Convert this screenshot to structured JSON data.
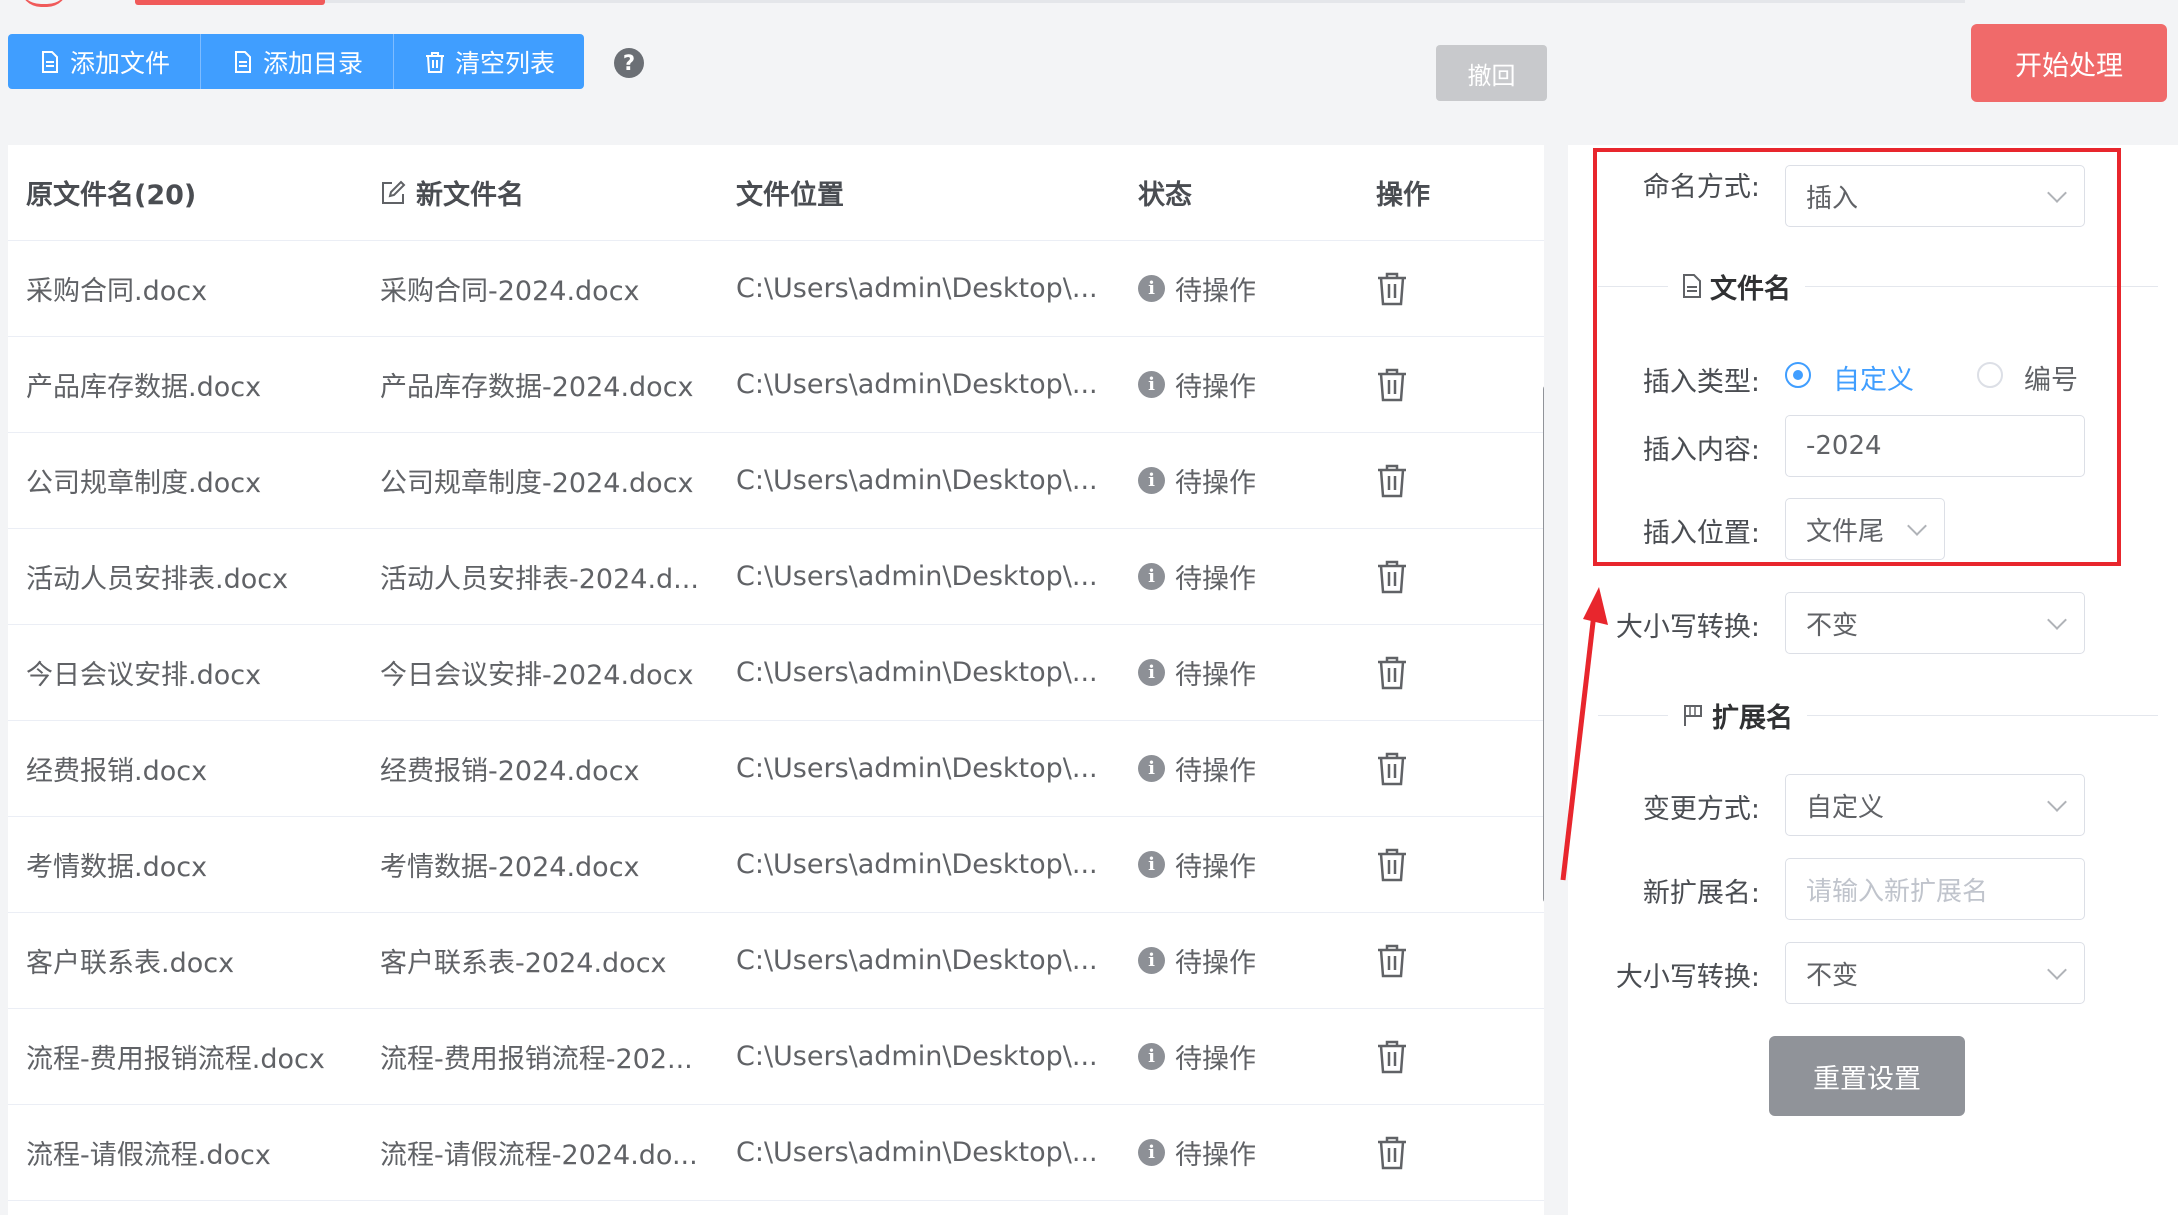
{
  "toolbar": {
    "add_file": "添加文件",
    "add_dir": "添加目录",
    "clear_list": "清空列表",
    "help": "?",
    "undo": "撤回",
    "start": "开始处理"
  },
  "table": {
    "headers": {
      "orig": "原文件名(20)",
      "new": "新文件名",
      "location": "文件位置",
      "status": "状态",
      "action": "操作"
    },
    "rows": [
      {
        "orig": "采购合同.docx",
        "new": "采购合同-2024.docx",
        "location": "C:\\Users\\admin\\Desktop\\...",
        "status": "待操作"
      },
      {
        "orig": "产品库存数据.docx",
        "new": "产品库存数据-2024.docx",
        "location": "C:\\Users\\admin\\Desktop\\...",
        "status": "待操作"
      },
      {
        "orig": "公司规章制度.docx",
        "new": "公司规章制度-2024.docx",
        "location": "C:\\Users\\admin\\Desktop\\...",
        "status": "待操作"
      },
      {
        "orig": "活动人员安排表.docx",
        "new": "活动人员安排表-2024.d...",
        "location": "C:\\Users\\admin\\Desktop\\...",
        "status": "待操作"
      },
      {
        "orig": "今日会议安排.docx",
        "new": "今日会议安排-2024.docx",
        "location": "C:\\Users\\admin\\Desktop\\...",
        "status": "待操作"
      },
      {
        "orig": "经费报销.docx",
        "new": "经费报销-2024.docx",
        "location": "C:\\Users\\admin\\Desktop\\...",
        "status": "待操作"
      },
      {
        "orig": "考情数据.docx",
        "new": "考情数据-2024.docx",
        "location": "C:\\Users\\admin\\Desktop\\...",
        "status": "待操作"
      },
      {
        "orig": "客户联系表.docx",
        "new": "客户联系表-2024.docx",
        "location": "C:\\Users\\admin\\Desktop\\...",
        "status": "待操作"
      },
      {
        "orig": "流程-费用报销流程.docx",
        "new": "流程-费用报销流程-202...",
        "location": "C:\\Users\\admin\\Desktop\\...",
        "status": "待操作"
      },
      {
        "orig": "流程-请假流程.docx",
        "new": "流程-请假流程-2024.do...",
        "location": "C:\\Users\\admin\\Desktop\\...",
        "status": "待操作"
      }
    ]
  },
  "settings": {
    "naming_label": "命名方式:",
    "naming_value": "插入",
    "filename_section": "文件名",
    "insert_type_label": "插入类型:",
    "insert_type_custom": "自定义",
    "insert_type_number": "编号",
    "insert_content_label": "插入内容:",
    "insert_content_value": "-2024",
    "insert_pos_label": "插入位置:",
    "insert_pos_value": "文件尾",
    "case_label": "大小写转换:",
    "case_value": "不变",
    "ext_section": "扩展名",
    "change_mode_label": "变更方式:",
    "change_mode_value": "自定义",
    "new_ext_label": "新扩展名:",
    "new_ext_placeholder": "请输入新扩展名",
    "ext_case_label": "大小写转换:",
    "ext_case_value": "不变",
    "reset": "重置设置"
  },
  "colors": {
    "primary": "#409eff",
    "danger": "#f06a6a",
    "annotation": "#e8262d"
  }
}
